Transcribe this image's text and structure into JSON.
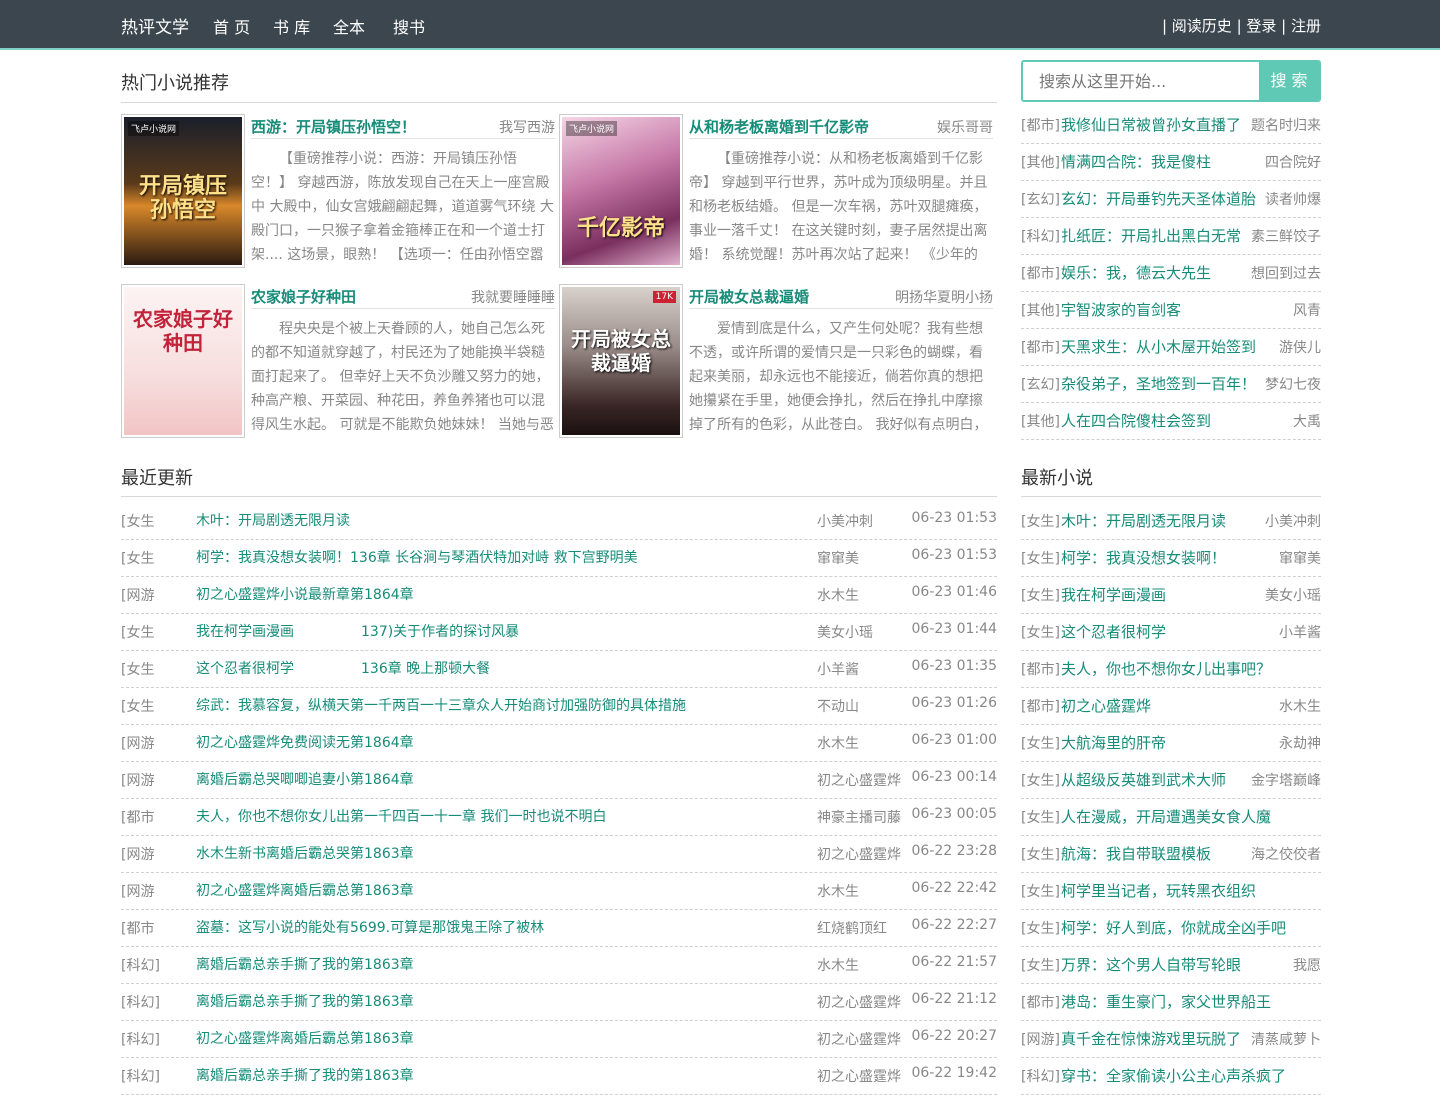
{
  "header": {
    "logo": "热评文学",
    "nav": [
      "首 页",
      "书 库",
      "全本",
      "搜书"
    ],
    "right": "| 阅读历史 | 登录 | 注册"
  },
  "hot": {
    "title": "热门小说推荐",
    "items": [
      {
        "name": "西游：开局镇压孙悟空！",
        "author": "我写西游",
        "desc": "【重磅推荐小说：西游：开局镇压孙悟空！】 穿越西游，陈放发现自己在天上一座宫殿中 大殿中，仙女宫娥翩翩起舞，道道雾气环绕 大殿门口，一只猴子拿着金箍棒正在和一个道士打架.... 这场景，眼熟！ 【选项一：任由孙悟空嚣",
        "cover_text": "开局镇压孙悟空",
        "cover_brand": "飞卢小说网"
      },
      {
        "name": "从和杨老板离婚到千亿影帝",
        "author": "娱乐哥哥",
        "desc": "【重磅推荐小说：从和杨老板离婚到千亿影帝】 穿越到平行世界，苏叶成为顶级明星。并且和杨老板结婚。 但是一次车祸，苏叶双腿瘫痪，事业一落千丈！ 在这关键时刻，妻子居然提出离婚！ 系统觉醒！苏叶再次站了起来！ 《少年的",
        "cover_text": "千亿影帝",
        "cover_brand": "飞卢小说网"
      },
      {
        "name": "农家娘子好种田",
        "author": "我就要睡睡睡",
        "desc": "程央央是个被上天眷顾的人，她自己怎么死的都不知道就穿越了，村民还为了她能换半袋糙面打起来了。 但幸好上天不负沙雕又努力的她，种高产粮、开菜园、种花田，养鱼养猪也可以混得风生水起。 可就是不能欺负她妹妹！ 当她与恶",
        "cover_text": "农家娘子好种田",
        "cover_brand": ""
      },
      {
        "name": "开局被女总裁逼婚",
        "author": "明扬华夏明小扬",
        "desc": "爱情到底是什么，又产生何处呢？我有些想不透，或许所谓的爱情只是一只彩色的蝴蝶，看起来美丽，却永远也不能接近，倘若你真的想把她攥紧在手里，她便会挣扎，然后在挣扎中摩擦掉了所有的色彩，从此苍白。 我好似有点明白，",
        "cover_text": "开局被女总裁逼婚",
        "cover_brand": "17K"
      }
    ]
  },
  "search": {
    "placeholder": "搜索从这里开始...",
    "button": "搜 索"
  },
  "rank": [
    {
      "cat": "[都市]",
      "name": "我修仙日常被曾孙女直播了",
      "author": "题名时归来"
    },
    {
      "cat": "[其他]",
      "name": "情满四合院：我是傻柱",
      "author": "四合院好"
    },
    {
      "cat": "[玄幻]",
      "name": "玄幻：开局垂钓先天圣体道胎",
      "author": "读者帅爆"
    },
    {
      "cat": "[科幻]",
      "name": "扎纸匠：开局扎出黑白无常",
      "author": "素三鲜饺子"
    },
    {
      "cat": "[都市]",
      "name": "娱乐：我，德云大先生",
      "author": "想回到过去"
    },
    {
      "cat": "[其他]",
      "name": "宇智波家的盲剑客",
      "author": "风青"
    },
    {
      "cat": "[都市]",
      "name": "天黑求生：从小木屋开始签到",
      "author": "游侠儿"
    },
    {
      "cat": "[玄幻]",
      "name": "杂役弟子，圣地签到一百年！",
      "author": "梦幻七夜"
    },
    {
      "cat": "[其他]",
      "name": "人在四合院傻柱会签到",
      "author": "大禹"
    }
  ],
  "updates": {
    "title": "最近更新",
    "rows": [
      {
        "cat": "[女生",
        "name": "木叶：开局剧透无限月读",
        "chapter": "",
        "author": "小美冲刺",
        "time": "06-23 01:53"
      },
      {
        "cat": "[女生",
        "name": "柯学：我真没想女装啊！136章 长谷涧与琴酒伏特加对峙 救下宫野明美",
        "chapter": "",
        "author": "窜窜美",
        "time": "06-23 01:53"
      },
      {
        "cat": "[网游",
        "name": "初之心盛霆烨小说最新章第1864章",
        "chapter": "",
        "author": "水木生",
        "time": "06-23 01:46"
      },
      {
        "cat": "[女生",
        "name": "我在柯学画漫画",
        "chapter": "137)关于作者的探讨风暴",
        "author": "美女小瑶",
        "time": "06-23 01:44"
      },
      {
        "cat": "[女生",
        "name": "这个忍者很柯学",
        "chapter": "136章 晚上那顿大餐",
        "author": "小羊酱",
        "time": "06-23 01:35"
      },
      {
        "cat": "[女生",
        "name": "综武：我慕容复，纵横天第一千两百一十三章众人开始商讨加强防御的具体措施",
        "chapter": "",
        "author": "不动山",
        "time": "06-23 01:26"
      },
      {
        "cat": "[网游",
        "name": "初之心盛霆烨免费阅读无第1864章",
        "chapter": "",
        "author": "水木生",
        "time": "06-23 01:00"
      },
      {
        "cat": "[网游",
        "name": "离婚后霸总哭唧唧追妻小第1864章",
        "chapter": "",
        "author": "初之心盛霆烨",
        "time": "06-23 00:14"
      },
      {
        "cat": "[都市",
        "name": "夫人，你也不想你女儿出第一千四百一十一章 我们一时也说不明白",
        "chapter": "",
        "author": "神豪主播司藤",
        "time": "06-23 00:05"
      },
      {
        "cat": "[网游",
        "name": "水木生新书离婚后霸总哭第1863章",
        "chapter": "",
        "author": "初之心盛霆烨",
        "time": "06-22 23:28"
      },
      {
        "cat": "[网游",
        "name": "初之心盛霆烨离婚后霸总第1863章",
        "chapter": "",
        "author": "水木生",
        "time": "06-22 22:42"
      },
      {
        "cat": "[都市",
        "name": "盗墓：这写小说的能处有5699.可算是那饿鬼王除了被林",
        "chapter": "",
        "author": "红烧鹤顶红",
        "time": "06-22 22:27"
      },
      {
        "cat": "[科幻]",
        "name": "离婚后霸总亲手撕了我的第1863章",
        "chapter": "",
        "author": "水木生",
        "time": "06-22 21:57"
      },
      {
        "cat": "[科幻]",
        "name": "离婚后霸总亲手撕了我的第1863章",
        "chapter": "",
        "author": "初之心盛霆烨",
        "time": "06-22 21:12"
      },
      {
        "cat": "[科幻]",
        "name": "初之心盛霆烨离婚后霸总第1863章",
        "chapter": "",
        "author": "初之心盛霆烨",
        "time": "06-22 20:27"
      },
      {
        "cat": "[科幻]",
        "name": "离婚后霸总亲手撕了我的第1863章",
        "chapter": "",
        "author": "初之心盛霆烨",
        "time": "06-22 19:42"
      }
    ]
  },
  "newest": {
    "title": "最新小说",
    "rows": [
      {
        "cat": "[女生]",
        "name": "木叶：开局剧透无限月读",
        "author": "小美冲刺"
      },
      {
        "cat": "[女生]",
        "name": "柯学：我真没想女装啊！",
        "author": "窜窜美"
      },
      {
        "cat": "[女生]",
        "name": "我在柯学画漫画",
        "author": "美女小瑶"
      },
      {
        "cat": "[女生]",
        "name": "这个忍者很柯学",
        "author": "小羊酱"
      },
      {
        "cat": "[都市]",
        "name": "夫人，你也不想你女儿出事吧？",
        "author": ""
      },
      {
        "cat": "[都市]",
        "name": "初之心盛霆烨",
        "author": "水木生"
      },
      {
        "cat": "[女生]",
        "name": "大航海里的肝帝",
        "author": "永劫神"
      },
      {
        "cat": "[女生]",
        "name": "从超级反英雄到武术大师",
        "author": "金字塔巅峰"
      },
      {
        "cat": "[女生]",
        "name": "人在漫威，开局遭遇美女食人魔",
        "author": ""
      },
      {
        "cat": "[女生]",
        "name": "航海：我自带联盟模板",
        "author": "海之佼佼者"
      },
      {
        "cat": "[女生]",
        "name": "柯学里当记者，玩转黑衣组织",
        "author": ""
      },
      {
        "cat": "[女生]",
        "name": "柯学：好人到底，你就成全凶手吧",
        "author": ""
      },
      {
        "cat": "[女生]",
        "name": "万界：这个男人自带写轮眼",
        "author": "我愿"
      },
      {
        "cat": "[都市]",
        "name": "港岛：重生豪门，家父世界船王",
        "author": ""
      },
      {
        "cat": "[网游]",
        "name": "真千金在惊悚游戏里玩脱了",
        "author": "清蒸咸萝卜"
      },
      {
        "cat": "[科幻]",
        "name": "穿书：全家偷读小公主心声杀疯了",
        "author": ""
      }
    ]
  },
  "colors": {
    "header_bg": "#3b464f",
    "accent": "#5fc9b5",
    "link": "#178c79"
  }
}
